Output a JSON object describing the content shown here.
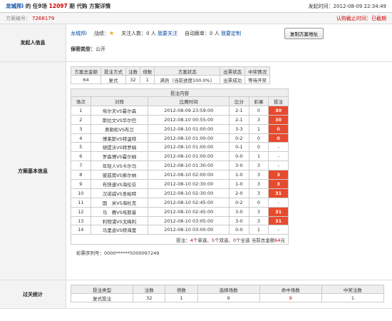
{
  "header": {
    "user": "龙城邦i",
    "text_mid": " 的 任9场 ",
    "issue": "12097",
    "text_end": " 期 代购 方案详情",
    "publish_label": "发起时间：",
    "publish_time": "2012-08-09 22:34:49"
  },
  "subheader": {
    "scheme_id_label": "方案编号：",
    "scheme_id": "7268179",
    "deadline_label": "认购截止时间：",
    "deadline": "已截期"
  },
  "sponsor": {
    "label": "发起人信息",
    "name": "龙城邦i",
    "record_label": "战绩：",
    "follow_label": "关注人数：",
    "follow_count": "0 人",
    "follow_link": "我要关注",
    "auto_label": "自动跟单：",
    "auto_count": "0 人",
    "auto_link": "我要定制",
    "copy_button": "复制方案地址",
    "privacy_label": "保密类型：",
    "privacy_value": "公开"
  },
  "basic": {
    "label": "方案基本信息",
    "summary_headers": [
      "方案总金额",
      "投注方式",
      "注数",
      "倍数",
      "方案状态",
      "出票状态",
      "中奖情况"
    ],
    "summary_values": [
      "64",
      "复式",
      "32",
      "1",
      "满员（当前进度100.0%）",
      "出票成功",
      "等待开奖"
    ],
    "matches_caption": "投注内容",
    "match_headers": [
      "场次",
      "对阵",
      "比赛时间",
      "比分",
      "彩果",
      "投注"
    ],
    "matches": [
      {
        "no": "1",
        "team": "埃尔夫VS霍尔森",
        "time": "2012-08-09 23:59:00",
        "score": "2-1",
        "result": "0",
        "bet": "30",
        "hit": true
      },
      {
        "no": "2",
        "team": "斯拉文VS华尔巴",
        "time": "2012-08-10 00:55:00",
        "score": "2-1",
        "result": "3",
        "bet": "30",
        "hit": true
      },
      {
        "no": "3",
        "team": "奥勒松VS布兰",
        "time": "2012-08-10 01:00:00",
        "score": "3-3",
        "result": "1",
        "bet": "0",
        "hit": true
      },
      {
        "no": "4",
        "team": "博莱斯VS特温特",
        "time": "2012-08-10 01:00:00",
        "score": "0-2",
        "result": "0",
        "bet": "0",
        "hit": true
      },
      {
        "no": "5",
        "team": "顿提沃VS特罗姆",
        "time": "2012-08-10 01:00:00",
        "score": "0-1",
        "result": "0",
        "bet": "-",
        "hit": false
      },
      {
        "no": "6",
        "team": "罗森博VS霍尔姆",
        "time": "2012-08-10 01:00:00",
        "score": "0-0",
        "result": "1",
        "bet": "-",
        "hit": false
      },
      {
        "no": "7",
        "team": "年轻人VS卡尔马",
        "time": "2012-08-10 01:30:00",
        "score": "3-0",
        "result": "3",
        "bet": "-",
        "hit": false
      },
      {
        "no": "8",
        "team": "彼兹南VS索尔纳",
        "time": "2012-08-10 02:00:00",
        "score": "1-0",
        "result": "3",
        "bet": "3",
        "hit": true
      },
      {
        "no": "9",
        "team": "布快速VS海伦芬",
        "time": "2012-08-10 02:30:00",
        "score": "1-0",
        "result": "3",
        "bet": "3",
        "hit": true
      },
      {
        "no": "10",
        "team": "汉诺威VS圣帕特",
        "time": "2012-08-10 02:30:00",
        "score": "2-0",
        "result": "3",
        "bet": "31",
        "hit": true
      },
      {
        "no": "11",
        "team": "国　米VS海杜克",
        "time": "2012-08-10 02:45:00",
        "score": "0-2",
        "result": "0",
        "bet": "-",
        "hit": false
      },
      {
        "no": "12",
        "team": "马　赛VS埃斯基",
        "time": "2012-08-10 02:45:00",
        "score": "3-0",
        "result": "3",
        "bet": "31",
        "hit": true
      },
      {
        "no": "13",
        "team": "利物浦VS戈梅利",
        "time": "2012-08-10 03:05:00",
        "score": "3-0",
        "result": "3",
        "bet": "31",
        "hit": true
      },
      {
        "no": "14",
        "team": "马里迪VS特海里",
        "time": "2012-08-10 03:00:00",
        "score": "0-0",
        "result": "1",
        "bet": "-",
        "hit": false
      }
    ],
    "footer": {
      "prefix": "投注：",
      "singles": "4",
      "singles_label": "个单选、",
      "doubles": "5",
      "doubles_label": "个双选、",
      "triples": "0",
      "triples_label": "个全选 当前总金额",
      "total": "64",
      "unit": "元"
    },
    "ticket_label": "彩票序列号：",
    "ticket_no": "0000******5000097249"
  },
  "stats": {
    "label": "过关统计",
    "headers": [
      "投注类型",
      "注数",
      "倍数",
      "选择场数",
      "命中场数",
      "中奖注数"
    ],
    "values": [
      "复式投注",
      "32",
      "1",
      "9",
      "9",
      "1"
    ]
  },
  "colors": {
    "accent_red": "#e84a2e",
    "link_blue": "#0a4ea8"
  }
}
